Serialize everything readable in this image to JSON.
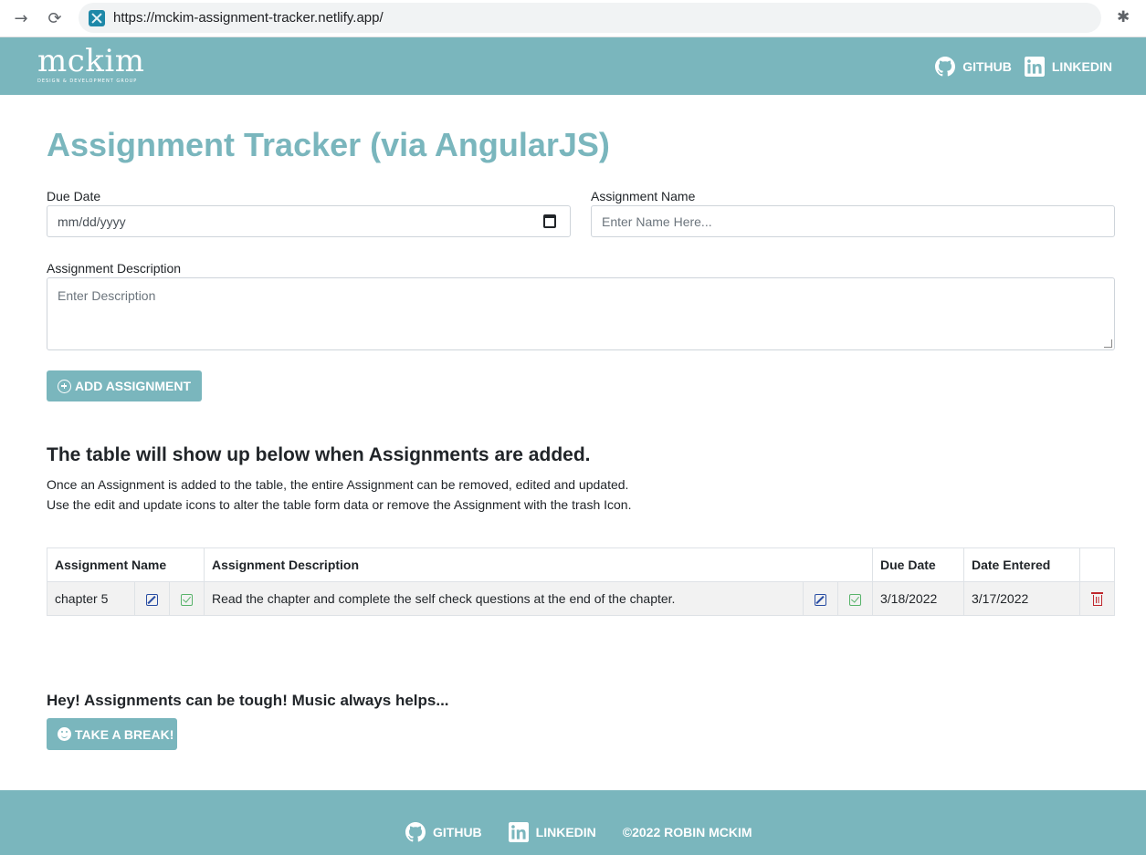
{
  "browser": {
    "url": "https://mckim-assignment-tracker.netlify.app/"
  },
  "header": {
    "logo_main": "mckim",
    "logo_sub": "DESIGN & DEVELOPMENT GROUP",
    "github_label": "GITHUB",
    "linkedin_label": "LINKEDIN"
  },
  "form": {
    "title": "Assignment Tracker (via AngularJS)",
    "due_date_label": "Due Date",
    "due_date_placeholder": "mm/dd/yyyy",
    "name_label": "Assignment Name",
    "name_placeholder": "Enter Name Here...",
    "description_label": "Assignment Description",
    "description_placeholder": "Enter Description",
    "add_button_label": "ADD ASSIGNMENT"
  },
  "info": {
    "heading": "The table will show up below when Assignments are added.",
    "line1": "Once an Assignment is added to the table, the entire Assignment can be removed, edited and updated.",
    "line2": "Use the edit and update icons to alter the table form data or remove the Assignment with the trash Icon."
  },
  "table": {
    "headers": {
      "name": "Assignment Name",
      "description": "Assignment Description",
      "due_date": "Due Date",
      "date_entered": "Date Entered"
    },
    "rows": [
      {
        "name": "chapter 5",
        "description": "Read the chapter and complete the self check questions at the end of the chapter.",
        "due_date": "3/18/2022",
        "date_entered": "3/17/2022"
      }
    ]
  },
  "break": {
    "text": "Hey! Assignments can be tough! Music always helps...",
    "button_label": "TAKE A BREAK!"
  },
  "footer": {
    "github_label": "GITHUB",
    "linkedin_label": "LINKEDIN",
    "copyright": "©2022 ROBIN MCKIM"
  },
  "colors": {
    "brand": "#7ab6bd",
    "edit": "#2a4ea3",
    "update": "#58b36a",
    "delete": "#c0272d"
  }
}
